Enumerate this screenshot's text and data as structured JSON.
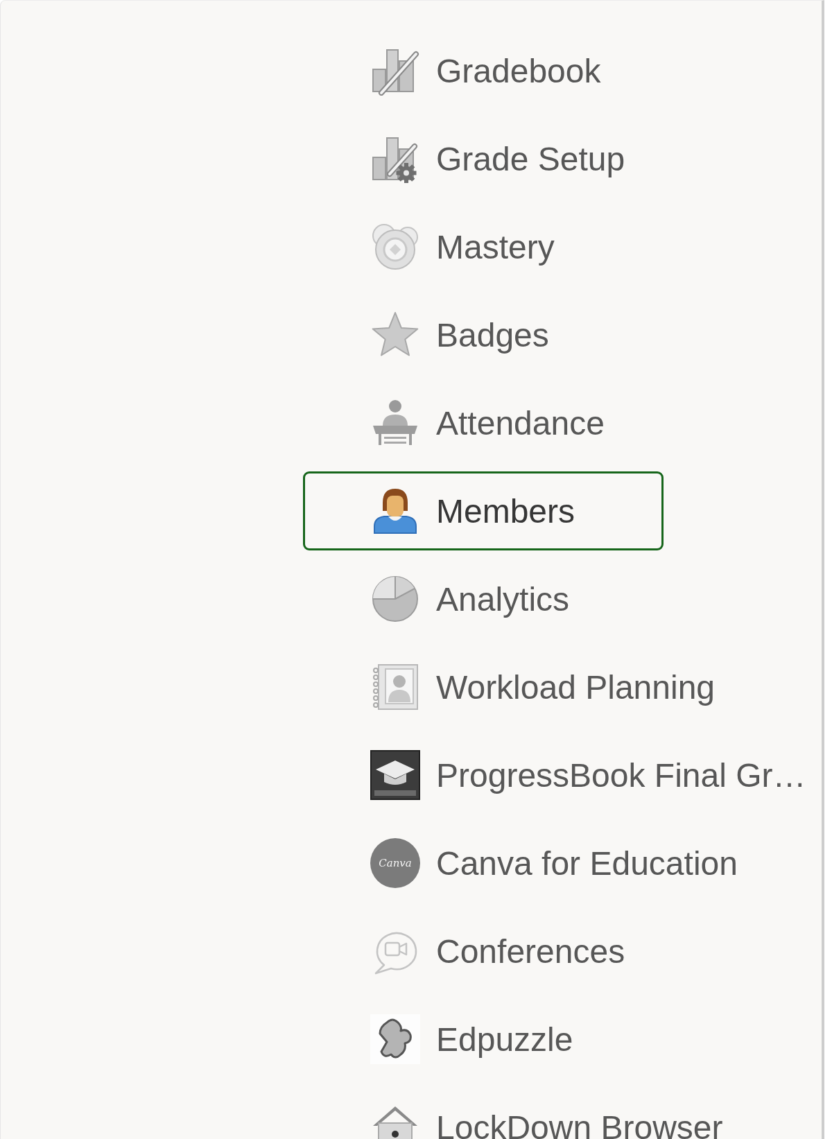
{
  "nav_menu": {
    "items": [
      {
        "label": "Gradebook",
        "selected": false
      },
      {
        "label": "Grade Setup",
        "selected": false
      },
      {
        "label": "Mastery",
        "selected": false
      },
      {
        "label": "Badges",
        "selected": false
      },
      {
        "label": "Attendance",
        "selected": false
      },
      {
        "label": "Members",
        "selected": true
      },
      {
        "label": "Analytics",
        "selected": false
      },
      {
        "label": "Workload Planning",
        "selected": false
      },
      {
        "label": "ProgressBook Final Gr…",
        "selected": false
      },
      {
        "label": "Canva for Education",
        "selected": false,
        "logo_text": "Canva"
      },
      {
        "label": "Conferences",
        "selected": false
      },
      {
        "label": "Edpuzzle",
        "selected": false
      },
      {
        "label": "LockDown Browser",
        "selected": false
      }
    ]
  }
}
